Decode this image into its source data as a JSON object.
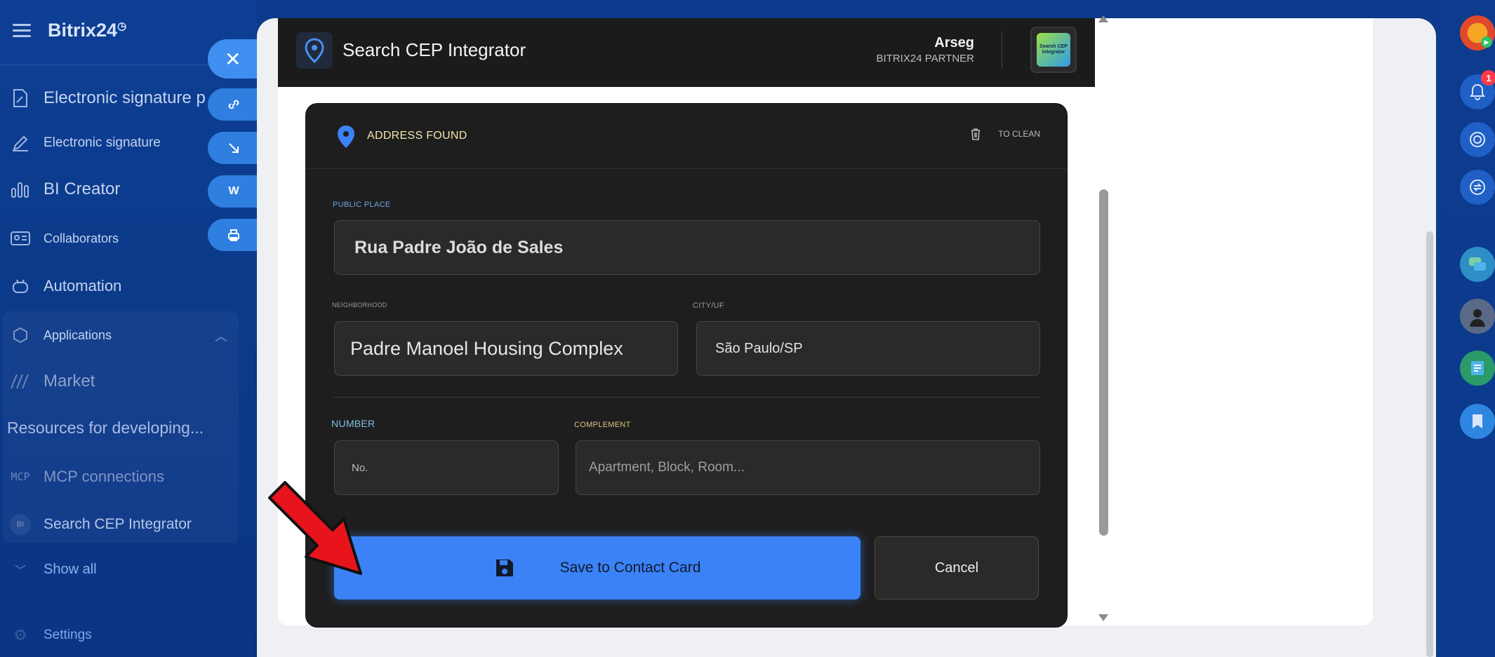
{
  "sidebar": {
    "brand": "Bitrix24",
    "items": [
      {
        "label": "Electronic signature p",
        "icon": "document-sign-icon"
      },
      {
        "label": "Electronic signature",
        "icon": "pen-icon"
      },
      {
        "label": "BI Creator",
        "icon": "bar-chart-icon"
      },
      {
        "label": "Collaborators",
        "icon": "id-card-icon"
      },
      {
        "label": "Automation",
        "icon": "robot-icon"
      },
      {
        "label": "Applications",
        "icon": "cube-icon"
      },
      {
        "label": "Market",
        "icon": "market-icon"
      },
      {
        "label": "Resources for developing...",
        "icon": ""
      },
      {
        "label": "MCP connections",
        "icon": "mcp-icon"
      },
      {
        "label": "Search CEP Integrator",
        "icon": "bi-badge-icon",
        "icon_text": "BI"
      },
      {
        "label": "Show all",
        "icon": "chevron-down-icon"
      },
      {
        "label": "Settings",
        "icon": "gear-icon"
      }
    ],
    "mcp_icon_text": "MCP",
    "side_action_w": "W"
  },
  "app": {
    "title": "Search CEP Integrator",
    "partner_name": "Arseg",
    "partner_sub": "BITRIX24 PARTNER",
    "logo_text": "Search CEP Integrator"
  },
  "card": {
    "found_label": "ADDRESS FOUND",
    "clean_label": "TO CLEAN",
    "public_place_label": "PUBLIC PLACE",
    "public_place_value": "Rua Padre João de Sales",
    "neighborhood_label": "NEIGHBORHOOD",
    "neighborhood_value": "Padre Manoel Housing Complex",
    "city_label": "CITY/UF",
    "city_value": "São Paulo/SP",
    "number_label": "NUMBER",
    "number_placeholder": "No.",
    "complement_label": "COMPLEMENT",
    "complement_placeholder": "Apartment, Block, Room...",
    "save_label": "Save to Contact Card",
    "cancel_label": "Cancel"
  },
  "rail": {
    "notifications_badge": "1"
  },
  "colors": {
    "accent": "#3b82f6",
    "sidebar_bg": "#0d3f95",
    "card_bg": "#1e1e1e",
    "arrow": "#e8141c"
  }
}
